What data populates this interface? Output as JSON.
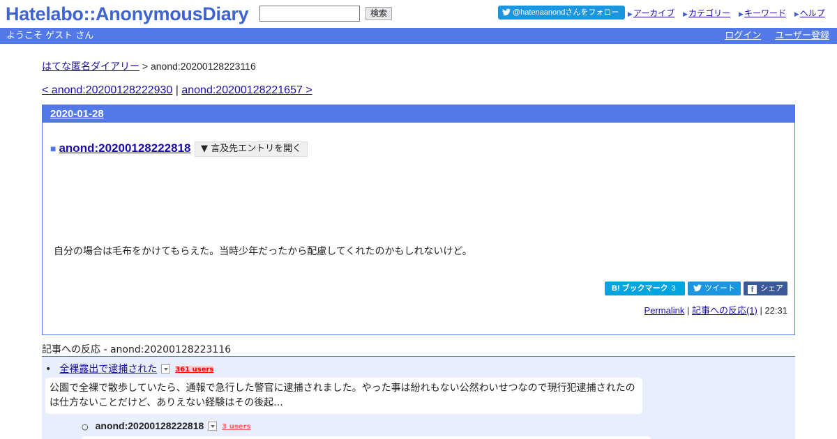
{
  "header": {
    "logo": "Hatelabo::AnonymousDiary",
    "search_button": "検索",
    "twitter_follow": "@hatenaanondさんをフォロー",
    "nav": [
      "アーカイブ",
      "カテゴリー",
      "キーワード",
      "ヘルプ"
    ],
    "welcome": "ようこそ ゲスト さん",
    "login": "ログイン",
    "register": "ユーザー登録"
  },
  "breadcrumb": {
    "home": "はてな匿名ダイアリー",
    "separator": " > ",
    "current": "anond:20200128223116"
  },
  "pager": {
    "prev": "< anond:20200128222930",
    "separator": " | ",
    "next": "anond:20200128221657 >"
  },
  "day": {
    "date": "2020-01-28",
    "entry_marker": "■",
    "entry_title": "anond:20200128222818",
    "toggle_button": "▼ 言及先エントリを開く",
    "body": "自分の場合は毛布をかけてもらえた。当時少年だったから配慮してくれたのかもしれないけど。",
    "share": {
      "hatena_label": "B! ブックマーク",
      "hatena_count": "3",
      "tweet": "ツイート",
      "facebook": "シェア"
    },
    "permalink": "Permalink",
    "reactions": "記事への反応(1)",
    "time": "22:31"
  },
  "references": {
    "title": "記事への反応 - anond:20200128223116",
    "items": [
      {
        "bullet": "•",
        "title": "全裸露出で逮捕された",
        "users": "361 users",
        "summary": "公園で全裸で散歩していたら、通報で急行した警官に逮捕されました。やった事は紛れもない公然わいせつなので現行犯逮捕されたのは仕方ないことだけど、ありえない経験はその後起..."
      },
      {
        "bullet": "○",
        "title": "anond:20200128222818",
        "users": "3 users"
      }
    ]
  },
  "colors": {
    "accent": "#5279e7",
    "logo": "#3f63cf",
    "twitter": "#1b95e0",
    "hatena": "#00a4de",
    "facebook": "#3b5998",
    "reference_bg": "#e8eefc"
  }
}
